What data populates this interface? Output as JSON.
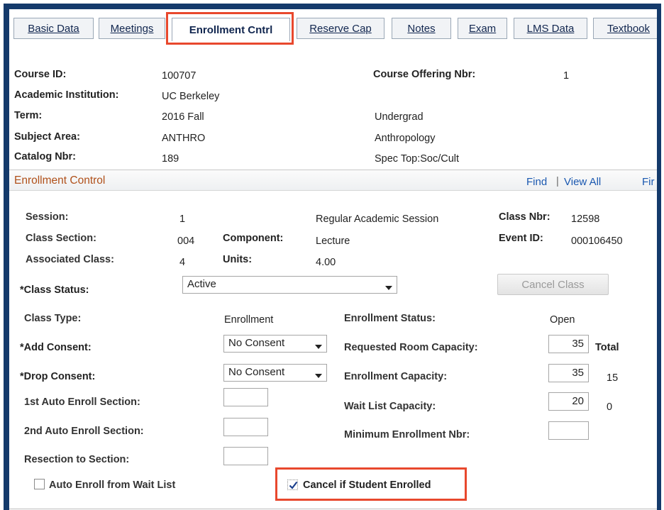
{
  "tabs": [
    {
      "label": "Basic Data",
      "active": false
    },
    {
      "label": "Meetings",
      "active": false
    },
    {
      "label": "Enrollment Cntrl",
      "active": true
    },
    {
      "label": "Reserve Cap",
      "active": false
    },
    {
      "label": "Notes",
      "active": false
    },
    {
      "label": "Exam",
      "active": false
    },
    {
      "label": "LMS Data",
      "active": false
    },
    {
      "label": "Textbook",
      "active": false
    }
  ],
  "course": {
    "course_id_label": "Course ID:",
    "course_id": "100707",
    "offering_label": "Course Offering Nbr:",
    "offering": "1",
    "institution_label": "Academic Institution:",
    "institution": "UC Berkeley",
    "term_label": "Term:",
    "term": "2016 Fall",
    "career": "Undergrad",
    "subject_label": "Subject Area:",
    "subject": "ANTHRO",
    "subject_desc": "Anthropology",
    "catalog_label": "Catalog Nbr:",
    "catalog": "189",
    "catalog_desc": "Spec Top:Soc/Cult"
  },
  "section": {
    "title": "Enrollment Control",
    "find": "Find",
    "sep": "|",
    "view_all": "View All",
    "first": "Fir"
  },
  "enroll": {
    "session_label": "Session:",
    "session": "1",
    "session_desc": "Regular Academic Session",
    "class_nbr_label": "Class Nbr:",
    "class_nbr": "12598",
    "class_section_label": "Class Section:",
    "class_section": "004",
    "component_label": "Component:",
    "component": "Lecture",
    "event_id_label": "Event ID:",
    "event_id": "000106450",
    "assoc_label": "Associated Class:",
    "assoc": "4",
    "units_label": "Units:",
    "units": "4.00",
    "status_label": "*Class Status:",
    "status": "Active",
    "cancel_class": "Cancel Class",
    "class_type_label": "Class Type:",
    "class_type": "Enrollment",
    "enroll_status_label": "Enrollment Status:",
    "enroll_status": "Open",
    "add_consent_label": "*Add Consent:",
    "add_consent": "No Consent",
    "req_room_label": "Requested Room Capacity:",
    "req_room": "35",
    "total_label": "Total",
    "drop_consent_label": "*Drop Consent:",
    "drop_consent": "No Consent",
    "enroll_cap_label": "Enrollment Capacity:",
    "enroll_cap": "35",
    "enroll_total": "15",
    "auto1_label": "1st Auto Enroll Section:",
    "auto1": "",
    "wait_cap_label": "Wait List Capacity:",
    "wait_cap": "20",
    "wait_total": "0",
    "auto2_label": "2nd Auto Enroll Section:",
    "auto2": "",
    "min_enroll_label": "Minimum Enrollment Nbr:",
    "min_enroll": "",
    "resection_label": "Resection to Section:",
    "resection": "",
    "auto_wait_label": "Auto Enroll from Wait List",
    "auto_wait_checked": false,
    "cancel_if_label": "Cancel if Student Enrolled",
    "cancel_if_checked": true
  },
  "colors": {
    "frame": "#143a6b",
    "highlight": "#e8482d",
    "section_title": "#b0501a",
    "link": "#1a58b0"
  }
}
